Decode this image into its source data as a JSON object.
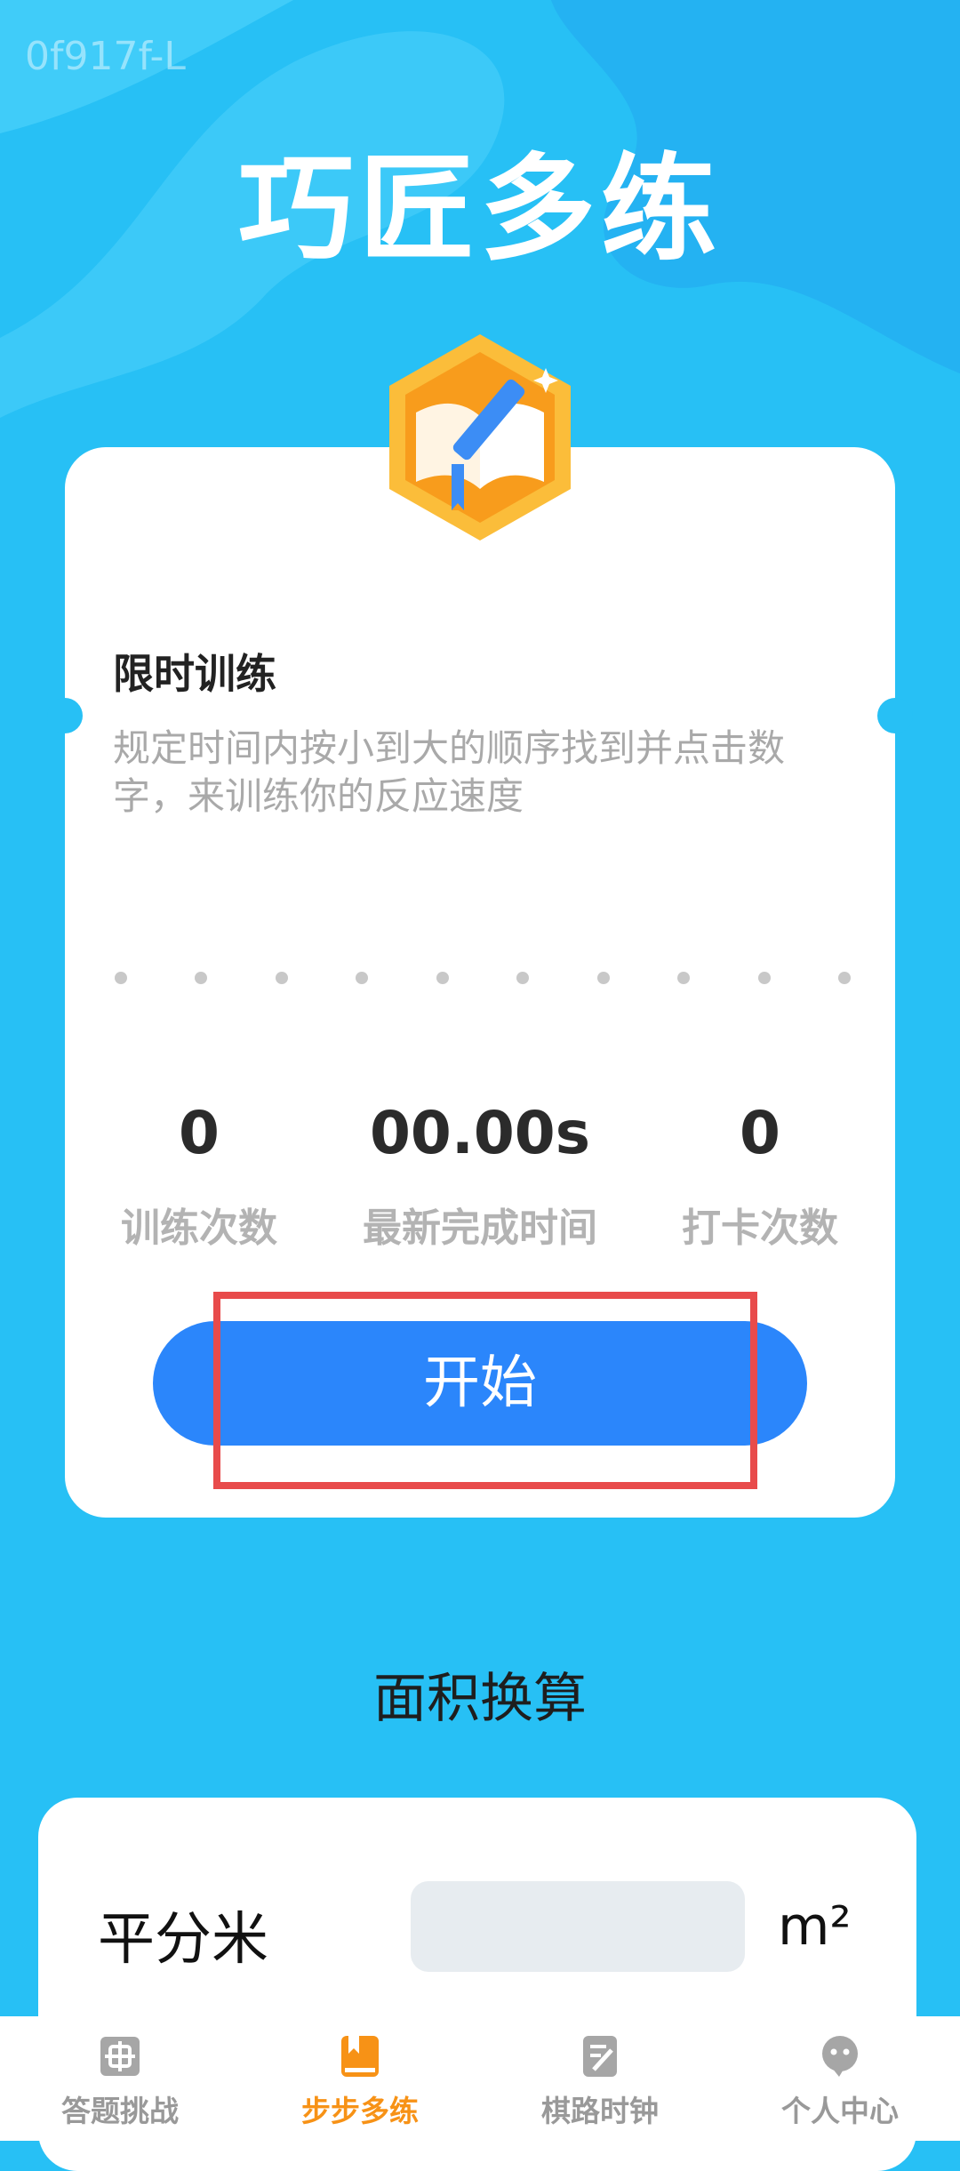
{
  "watermark": "0f917f-L",
  "app_title": "巧匠多练",
  "card": {
    "title": "限时训练",
    "description": "规定时间内按小到大的顺序找到并点击数字，来训练你的反应速度",
    "stats": [
      {
        "value": "0",
        "label": "训练次数"
      },
      {
        "value": "00.00s",
        "label": "最新完成时间"
      },
      {
        "value": "0",
        "label": "打卡次数"
      }
    ],
    "start_label": "开始"
  },
  "converter": {
    "section_title": "面积换算",
    "row_label": "平分米",
    "input_value": "",
    "unit": "m²"
  },
  "tabs": [
    {
      "label": "答题挑战",
      "icon": "puzzle-icon",
      "active": false
    },
    {
      "label": "步步多练",
      "icon": "book-icon",
      "active": true
    },
    {
      "label": "棋路时钟",
      "icon": "note-edit-icon",
      "active": false
    },
    {
      "label": "个人中心",
      "icon": "chat-bubble-icon",
      "active": false
    }
  ],
  "colors": {
    "background": "#27c0f5",
    "accent": "#2b86fb",
    "active_tab": "#f79216",
    "highlight": "#e84b4b"
  }
}
